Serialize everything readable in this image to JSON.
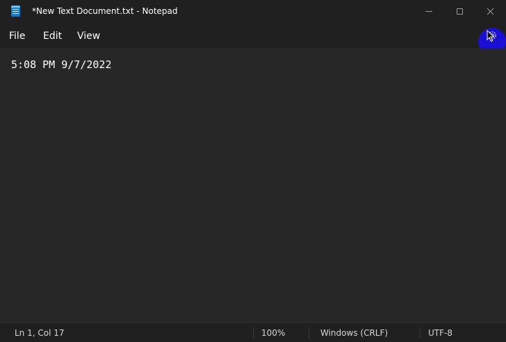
{
  "window": {
    "title": "*New Text Document.txt - Notepad",
    "app_icon": "notepad-icon"
  },
  "caption_buttons": {
    "minimize_icon": "minimize-icon",
    "maximize_icon": "maximize-icon",
    "close_icon": "close-icon"
  },
  "menu": {
    "items": [
      {
        "label": "File"
      },
      {
        "label": "Edit"
      },
      {
        "label": "View"
      }
    ],
    "settings_icon": "gear-icon"
  },
  "editor": {
    "content": "5:08 PM 9/7/2022"
  },
  "status_bar": {
    "position": "Ln 1, Col 17",
    "zoom": "100%",
    "line_ending": "Windows (CRLF)",
    "encoding": "UTF-8"
  },
  "colors": {
    "chrome": "#202020",
    "editor_bg": "#272727",
    "highlight": "#1a0fd4"
  }
}
